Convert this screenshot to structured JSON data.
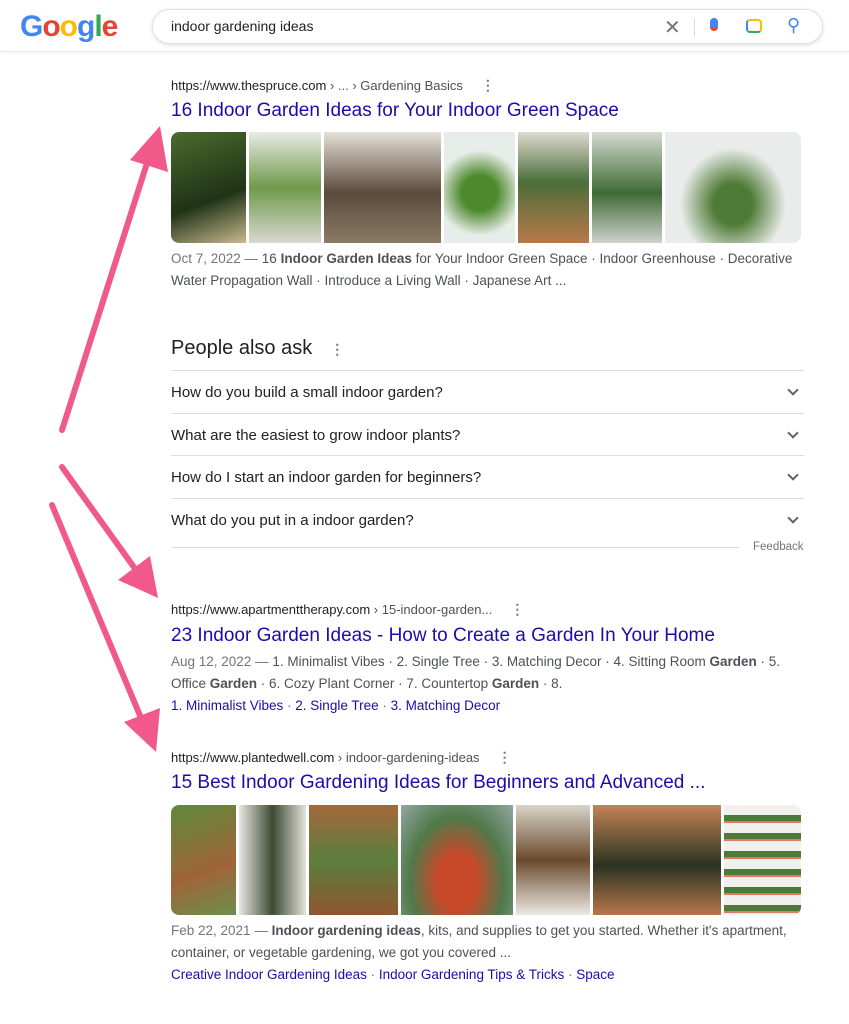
{
  "header": {
    "logo": "Google",
    "query": "indoor gardening ideas",
    "icons": [
      "close-icon",
      "mic-icon",
      "camera-icon",
      "search-icon"
    ]
  },
  "results": [
    {
      "url": "https://www.thespruce.com",
      "crumb": " › ... › Gardening Basics",
      "title": "16 Indoor Garden Ideas for Your Indoor Green Space",
      "date": "Oct 7, 2022 — ",
      "snip_pre": "16 ",
      "snip_bold": "Indoor Garden Ideas",
      "snip_post": " for Your Indoor Green Space · Indoor Greenhouse · Decorative Water Propagation Wall · Introduce a Living Wall · Japanese Art ..."
    },
    {
      "url": "https://www.apartmenttherapy.com",
      "crumb": " › 15-indoor-garden...",
      "title": "23 Indoor Garden Ideas - How to Create a Garden In Your Home",
      "date": "Aug 12, 2022 — ",
      "snip_a": "1. Minimalist Vibes · 2. Single Tree · 3. Matching Decor · 4. Sitting Room ",
      "bold": "Garden",
      "snip_b": " · 5. Office ",
      "snip_c": " · 6. Cozy Plant Corner · 7. Countertop ",
      "snip_d": " · 8.",
      "links": [
        "1. Minimalist Vibes",
        "2. Single Tree",
        "3. Matching Decor"
      ]
    },
    {
      "url": "https://www.plantedwell.com",
      "crumb": " › indoor-gardening-ideas",
      "title": "15 Best Indoor Gardening Ideas for Beginners and Advanced ...",
      "date": "Feb 22, 2021 — ",
      "snip_bold": "Indoor gardening ideas",
      "snip_post": ", kits, and supplies to get you started. Whether it's apartment, container, or vegetable gardening, we got you covered ...",
      "links": [
        "Creative Indoor Gardening Ideas",
        "Indoor Gardening Tips & Tricks",
        "Space"
      ]
    }
  ],
  "paa": {
    "heading": "People also ask",
    "questions": [
      "How do you build a small indoor garden?",
      "What are the easiest to grow indoor plants?",
      "How do I start an indoor garden for beginners?",
      "What do you put in a indoor garden?"
    ],
    "feedback": "Feedback"
  },
  "colors": {
    "link": "#1a0dab",
    "arrow": "#f0598a"
  }
}
